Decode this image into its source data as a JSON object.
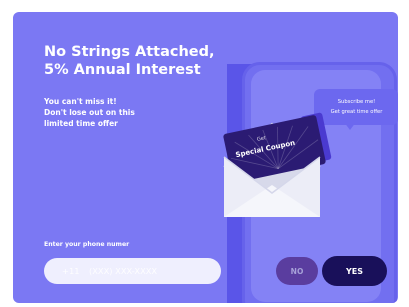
{
  "promo": {
    "title": "No Strings Attached,\n5% Annual Interest",
    "subtitle": "You can't miss it!\nDon't lose out on this\nlimited time offer",
    "phone_label": "Enter your phone numer",
    "phone_prefix": "+11",
    "phone_placeholder": "(XXX) XXX-XXXX",
    "no_label": "NO",
    "yes_label": "YES"
  },
  "illustration": {
    "tooltip_title": "Subscribe me!",
    "tooltip_subtitle": "Get great time offer",
    "coupon_top": "Get",
    "coupon_main": "Special Coupon"
  },
  "colors": {
    "background": "#7b78f3",
    "yes_button": "#19105a",
    "no_button": "#5a3d9f"
  }
}
